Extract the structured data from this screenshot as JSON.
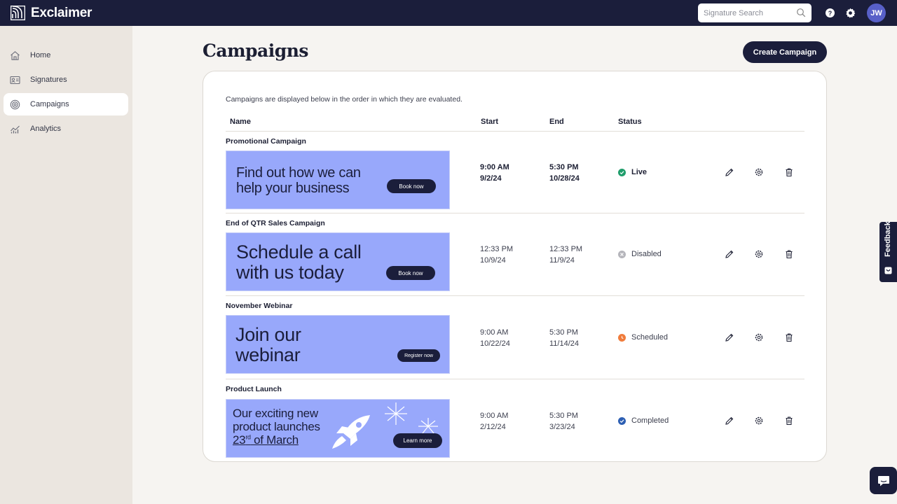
{
  "app": {
    "brand": "Exclaimer"
  },
  "header": {
    "search_placeholder": "Signature Search",
    "avatar_initials": "JW",
    "icons": [
      "help-icon",
      "settings-icon",
      "search-icon"
    ]
  },
  "sidebar": {
    "items": [
      {
        "label": "Home",
        "icon": "home-icon",
        "active": false
      },
      {
        "label": "Signatures",
        "icon": "signature-card-icon",
        "active": false
      },
      {
        "label": "Campaigns",
        "icon": "target-icon",
        "active": true
      },
      {
        "label": "Analytics",
        "icon": "analytics-chart-icon",
        "active": false
      }
    ]
  },
  "main": {
    "title": "Campaigns",
    "create_label": "Create Campaign",
    "intro": "Campaigns are displayed below in the order in which they are evaluated.",
    "columns": [
      "Name",
      "Start",
      "End",
      "Status"
    ],
    "campaigns": [
      {
        "name": "Promotional Campaign",
        "banner_line1": "Find out how we can",
        "banner_line2": "help your business",
        "banner_button": "Book now",
        "start_time": "9:00 AM",
        "start_date": "9/2/24",
        "end_time": "5:30 PM",
        "end_date": "10/28/24",
        "status": "Live"
      },
      {
        "name": "End of QTR Sales Campaign",
        "banner_line1": "Schedule a call",
        "banner_line2": "with us today",
        "banner_button": "Book now",
        "start_time": "12:33 PM",
        "start_date": "10/9/24",
        "end_time": "12:33 PM",
        "end_date": "11/9/24",
        "status": "Disabled"
      },
      {
        "name": "November Webinar",
        "banner_line1": "Join our",
        "banner_line2": "webinar",
        "banner_button": "Register now",
        "start_time": "9:00 AM",
        "start_date": "10/22/24",
        "end_time": "5:30 PM",
        "end_date": "11/14/24",
        "status": "Scheduled"
      },
      {
        "name": "Product Launch",
        "banner_line1": "Our exciting new",
        "banner_line2": "product launches",
        "banner_line3_main": "23",
        "banner_line3_sup": "rd",
        "banner_line3_rest": " of March",
        "banner_button": "Learn more",
        "start_time": "9:00 AM",
        "start_date": "2/12/24",
        "end_time": "5:30 PM",
        "end_date": "3/23/24",
        "status": "Completed"
      }
    ]
  },
  "status_colors": {
    "Live": "#1f9d6b",
    "Disabled": "#b5b5bb",
    "Scheduled": "#f07c3c",
    "Completed": "#2d5fb3"
  },
  "feedback_label": "Feedback"
}
